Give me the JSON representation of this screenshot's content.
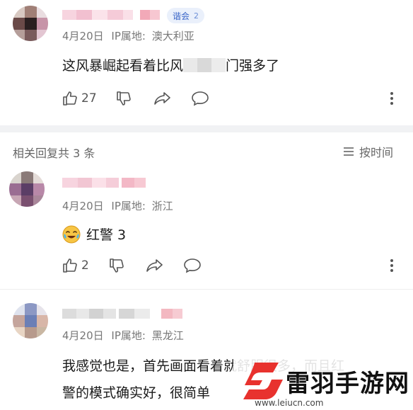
{
  "comment1": {
    "badge_label": "谐会",
    "badge_num": "2",
    "date": "4月20日",
    "ip_label": "IP属地:",
    "ip_place": "澳大利亚",
    "text_start": "这风暴崛起看着比风",
    "text_end": "门强多了",
    "likes": "27"
  },
  "thread": {
    "header": "相关回复共 3 条",
    "sort_label": "按时间"
  },
  "reply1": {
    "date": "4月20日",
    "ip_label": "IP属地:",
    "ip_place": "浙江",
    "text": "红警 3",
    "likes": "2"
  },
  "reply2": {
    "date": "4月20日",
    "ip_label": "IP属地:",
    "ip_place": "黑龙江",
    "line1": "我感觉也是，首先画面看着就舒服很多，而且红",
    "line2": "警的模式确实好，很简单"
  },
  "watermark": {
    "brand": "雷羽手游网",
    "url": "www.leiucn.com"
  },
  "colors": {
    "accent_red": "#e8322e",
    "badge_bg": "#eaf0fb",
    "badge_text": "#3b66c8",
    "meta_gray": "#777777"
  }
}
